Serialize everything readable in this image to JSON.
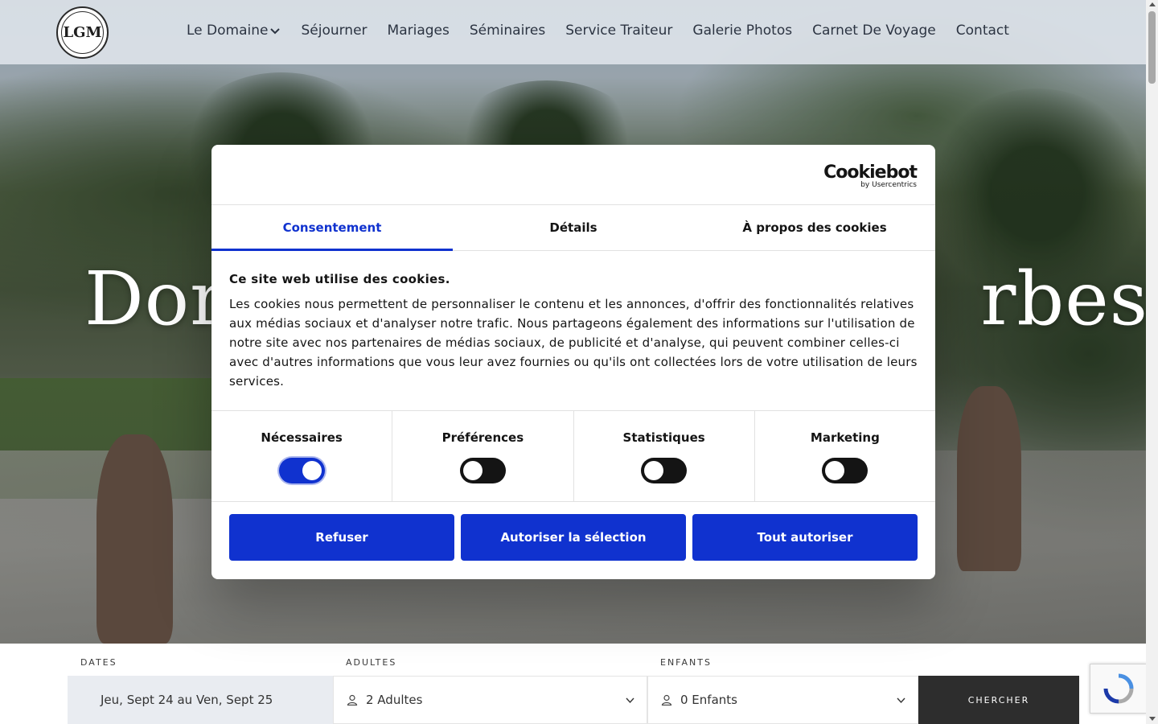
{
  "header": {
    "logo_text": "LGM",
    "nav": [
      {
        "label": "Le Domaine"
      },
      {
        "label": "Séjourner"
      },
      {
        "label": "Mariages"
      },
      {
        "label": "Séminaires"
      },
      {
        "label": "Service Traiteur"
      },
      {
        "label": "Galerie Photos"
      },
      {
        "label": "Carnet De Voyage"
      },
      {
        "label": "Contact"
      }
    ]
  },
  "hero": {
    "title_visible_left": "Dom",
    "title_visible_right": "rbes"
  },
  "cookie_dialog": {
    "brand": "Cookiebot",
    "brand_sub": "by Usercentrics",
    "tabs": [
      "Consentement",
      "Détails",
      "À propos des cookies"
    ],
    "active_tab": "Consentement",
    "heading": "Ce site web utilise des cookies.",
    "text": "Les cookies nous permettent de personnaliser le contenu et les annonces, d'offrir des fonctionnalités relatives aux médias sociaux et d'analyser notre trafic. Nous partageons également des informations sur l'utilisation de notre site avec nos partenaires de médias sociaux, de publicité et d'analyse, qui peuvent combiner celles-ci avec d'autres informations que vous leur avez fournies ou qu'ils ont collectées lors de votre utilisation de leurs services.",
    "toggles": [
      {
        "label": "Nécessaires",
        "on": true
      },
      {
        "label": "Préférences",
        "on": false
      },
      {
        "label": "Statistiques",
        "on": false
      },
      {
        "label": "Marketing",
        "on": false
      }
    ],
    "buttons": {
      "refuse": "Refuser",
      "allow_selection": "Autoriser la sélection",
      "allow_all": "Tout autoriser"
    },
    "accent_color": "#1032cf"
  },
  "booking": {
    "dates_label": "DATES",
    "dates_value": "Jeu, Sept 24 au Ven, Sept 25",
    "adults_label": "ADULTES",
    "adults_value": "2 Adultes",
    "kids_label": "ENFANTS",
    "kids_value": "0 Enfants",
    "search_label": "CHERCHER"
  }
}
